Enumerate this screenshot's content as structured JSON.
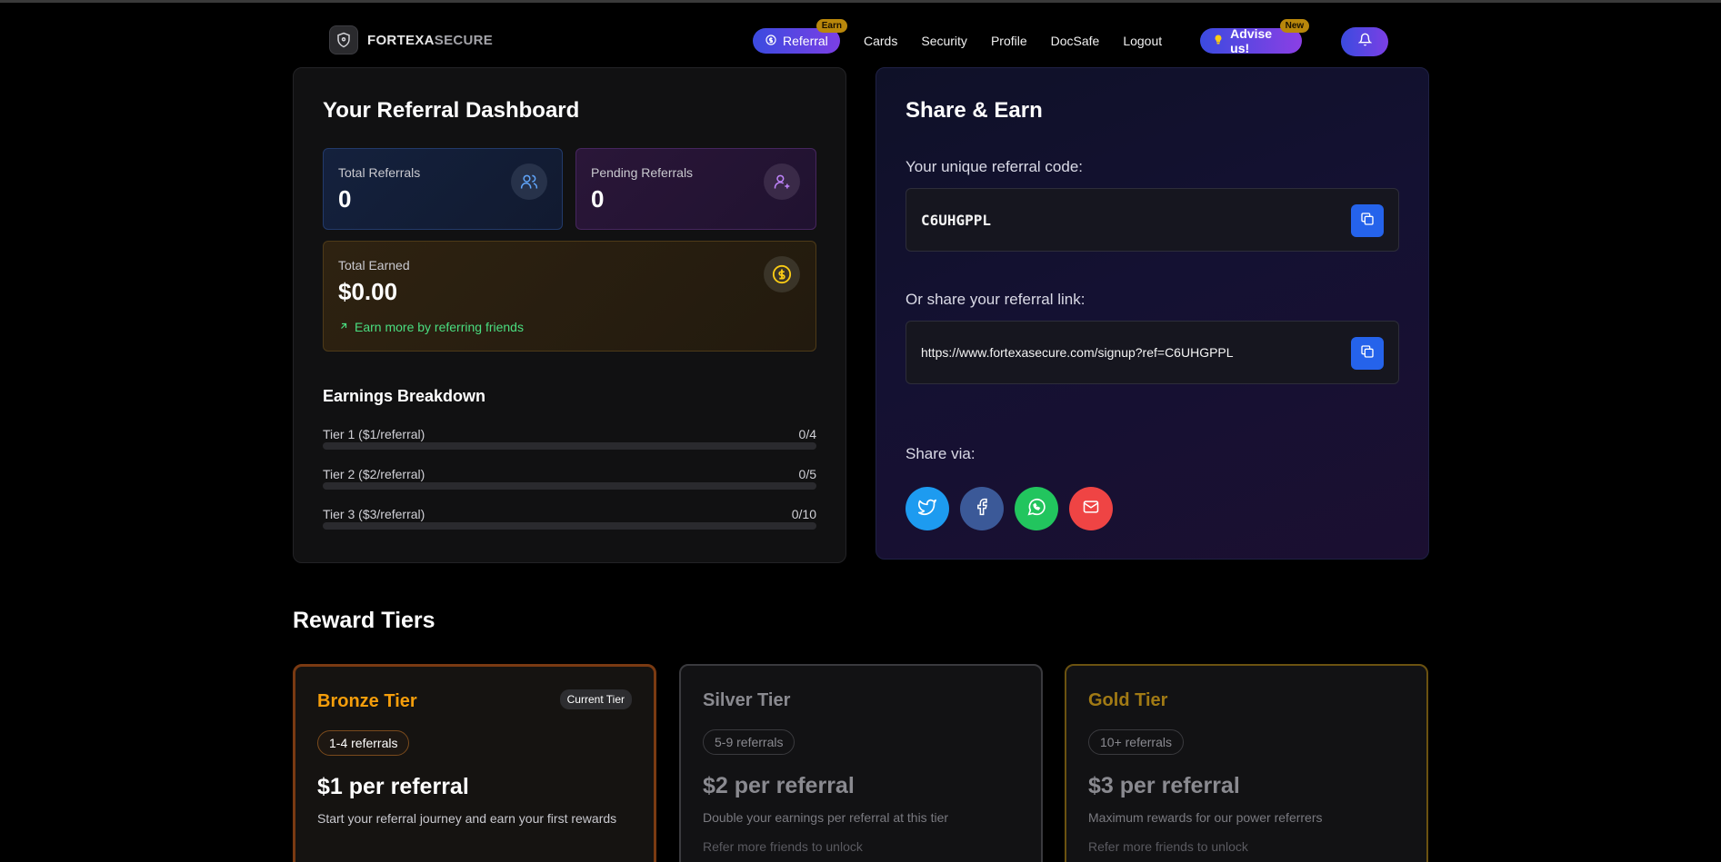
{
  "brand": {
    "name_main": "FORTEXA",
    "name_dim": "SECURE"
  },
  "nav": {
    "referral": "Referral",
    "referral_tag": "Earn",
    "items": [
      "Cards",
      "Security",
      "Profile",
      "DocSafe",
      "Logout"
    ],
    "advise": "Advise us!",
    "advise_tag": "New"
  },
  "dashboard": {
    "title": "Your Referral Dashboard",
    "total_referrals_label": "Total Referrals",
    "total_referrals": "0",
    "pending_referrals_label": "Pending Referrals",
    "pending_referrals": "0",
    "total_earned_label": "Total Earned",
    "total_earned": "$0.00",
    "earn_more": "Earn more by referring friends",
    "breakdown_title": "Earnings Breakdown",
    "tiers": [
      {
        "label": "Tier 1 ($1/referral)",
        "count": "0/4",
        "progress": 0
      },
      {
        "label": "Tier 2 ($2/referral)",
        "count": "0/5",
        "progress": 0
      },
      {
        "label": "Tier 3 ($3/referral)",
        "count": "0/10",
        "progress": 0
      }
    ]
  },
  "share": {
    "title": "Share & Earn",
    "code_label": "Your unique referral code:",
    "code": "C6UHGPPL",
    "link_label": "Or share your referral link:",
    "link": "https://www.fortexasecure.com/signup?ref=C6UHGPPL",
    "via_label": "Share via:",
    "buttons": [
      {
        "icon": "twitter-icon",
        "color": "#1d9bf0"
      },
      {
        "icon": "facebook-icon",
        "color": "#3b5998"
      },
      {
        "icon": "whatsapp-icon",
        "color": "#22c55e"
      },
      {
        "icon": "mail-icon",
        "color": "#ef4444"
      }
    ]
  },
  "reward_tiers": {
    "title": "Reward Tiers",
    "cards": [
      {
        "name": "Bronze Tier",
        "badge": "Current Tier",
        "range": "1-4 referrals",
        "price": "$1 per referral",
        "desc": "Start your referral journey and earn your first rewards",
        "unlock": ""
      },
      {
        "name": "Silver Tier",
        "badge": "",
        "range": "5-9 referrals",
        "price": "$2 per referral",
        "desc": "Double your earnings per referral at this tier",
        "unlock": "Refer more friends to unlock"
      },
      {
        "name": "Gold Tier",
        "badge": "",
        "range": "10+ referrals",
        "price": "$3 per referral",
        "desc": "Maximum rewards for our power referrers",
        "unlock": "Refer more friends to unlock"
      }
    ]
  },
  "colors": {
    "accent": "#2563eb",
    "bronze": "#f59e0b",
    "gold": "#a17a14",
    "success": "#4ade80"
  }
}
